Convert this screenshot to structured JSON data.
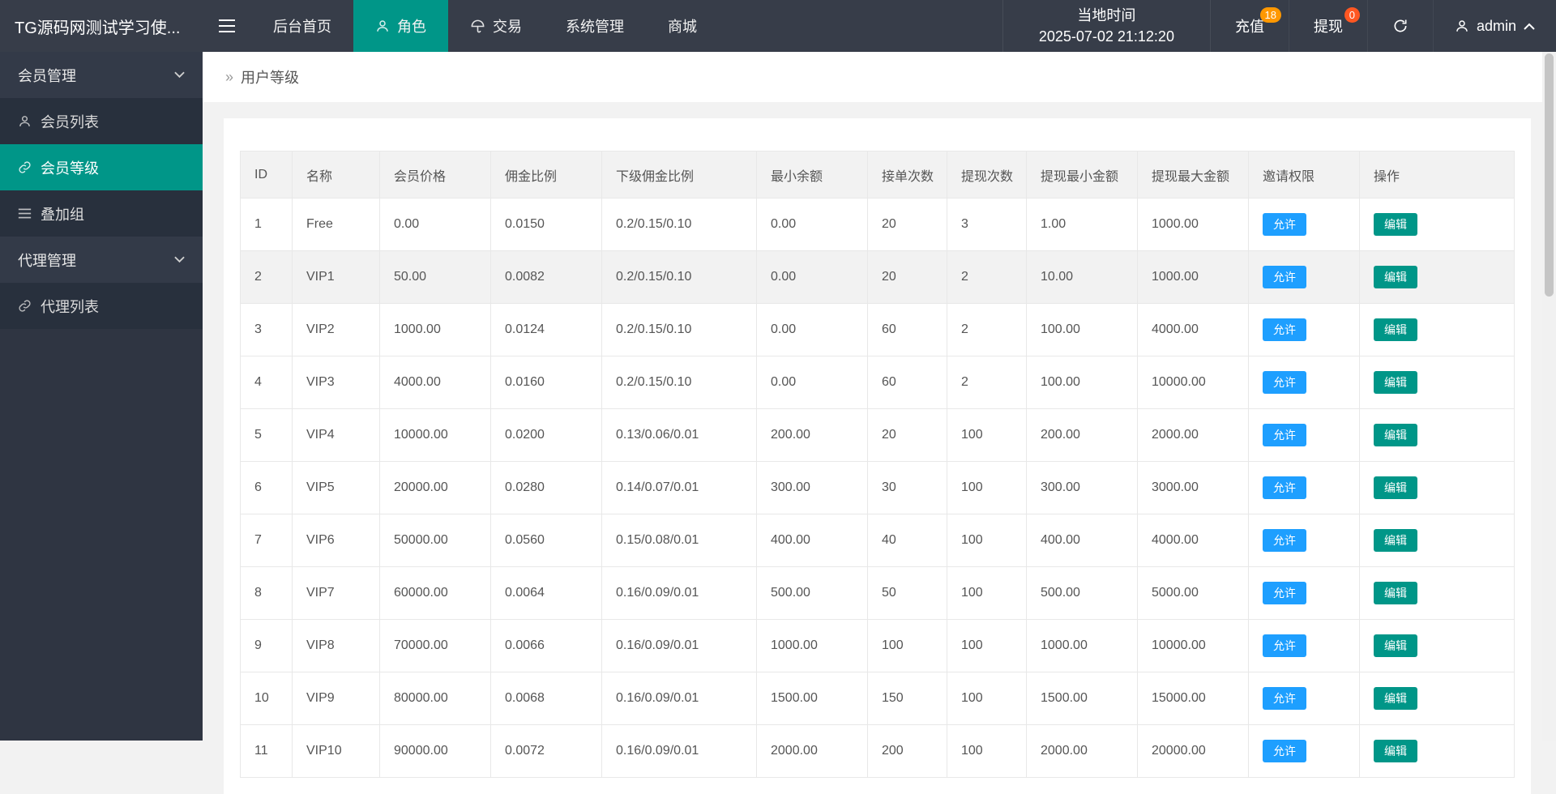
{
  "topbar": {
    "title": "TG源码网测试学习使...",
    "nav": [
      {
        "label": "后台首页"
      },
      {
        "label": "角色"
      },
      {
        "label": "交易"
      },
      {
        "label": "系统管理"
      },
      {
        "label": "商城"
      }
    ],
    "time_label": "当地时间",
    "time_value": "2025-07-02 21:12:20",
    "recharge_label": "充值",
    "recharge_badge": "18",
    "withdraw_label": "提现",
    "withdraw_badge": "0",
    "username": "admin",
    "colors": {
      "active_bg": "#009688",
      "recharge_badge_bg": "#ff9800",
      "withdraw_badge_bg": "#ff5722"
    }
  },
  "sidebar": {
    "items": [
      {
        "label": "会员管理"
      },
      {
        "label": "会员列表"
      },
      {
        "label": "会员等级"
      },
      {
        "label": "叠加组"
      },
      {
        "label": "代理管理"
      },
      {
        "label": "代理列表"
      }
    ]
  },
  "breadcrumb": {
    "title": "用户等级"
  },
  "table": {
    "headers": [
      "ID",
      "名称",
      "会员价格",
      "佣金比例",
      "下级佣金比例",
      "最小余额",
      "接单次数",
      "提现次数",
      "提现最小金额",
      "提现最大金额",
      "邀请权限",
      "操作"
    ],
    "allow_label": "允许",
    "edit_label": "编辑",
    "allow_color": "#1e9fff",
    "edit_color": "#009688",
    "rows": [
      {
        "id": "1",
        "name": "Free",
        "price": "0.00",
        "commission": "0.0150",
        "sub_commission": "0.2/0.15/0.10",
        "min_balance": "0.00",
        "orders": "20",
        "withdraw_times": "3",
        "withdraw_min": "1.00",
        "withdraw_max": "1000.00",
        "highlight": false
      },
      {
        "id": "2",
        "name": "VIP1",
        "price": "50.00",
        "commission": "0.0082",
        "sub_commission": "0.2/0.15/0.10",
        "min_balance": "0.00",
        "orders": "20",
        "withdraw_times": "2",
        "withdraw_min": "10.00",
        "withdraw_max": "1000.00",
        "highlight": true
      },
      {
        "id": "3",
        "name": "VIP2",
        "price": "1000.00",
        "commission": "0.0124",
        "sub_commission": "0.2/0.15/0.10",
        "min_balance": "0.00",
        "orders": "60",
        "withdraw_times": "2",
        "withdraw_min": "100.00",
        "withdraw_max": "4000.00",
        "highlight": false
      },
      {
        "id": "4",
        "name": "VIP3",
        "price": "4000.00",
        "commission": "0.0160",
        "sub_commission": "0.2/0.15/0.10",
        "min_balance": "0.00",
        "orders": "60",
        "withdraw_times": "2",
        "withdraw_min": "100.00",
        "withdraw_max": "10000.00",
        "highlight": false
      },
      {
        "id": "5",
        "name": "VIP4",
        "price": "10000.00",
        "commission": "0.0200",
        "sub_commission": "0.13/0.06/0.01",
        "min_balance": "200.00",
        "orders": "20",
        "withdraw_times": "100",
        "withdraw_min": "200.00",
        "withdraw_max": "2000.00",
        "highlight": false
      },
      {
        "id": "6",
        "name": "VIP5",
        "price": "20000.00",
        "commission": "0.0280",
        "sub_commission": "0.14/0.07/0.01",
        "min_balance": "300.00",
        "orders": "30",
        "withdraw_times": "100",
        "withdraw_min": "300.00",
        "withdraw_max": "3000.00",
        "highlight": false
      },
      {
        "id": "7",
        "name": "VIP6",
        "price": "50000.00",
        "commission": "0.0560",
        "sub_commission": "0.15/0.08/0.01",
        "min_balance": "400.00",
        "orders": "40",
        "withdraw_times": "100",
        "withdraw_min": "400.00",
        "withdraw_max": "4000.00",
        "highlight": false
      },
      {
        "id": "8",
        "name": "VIP7",
        "price": "60000.00",
        "commission": "0.0064",
        "sub_commission": "0.16/0.09/0.01",
        "min_balance": "500.00",
        "orders": "50",
        "withdraw_times": "100",
        "withdraw_min": "500.00",
        "withdraw_max": "5000.00",
        "highlight": false
      },
      {
        "id": "9",
        "name": "VIP8",
        "price": "70000.00",
        "commission": "0.0066",
        "sub_commission": "0.16/0.09/0.01",
        "min_balance": "1000.00",
        "orders": "100",
        "withdraw_times": "100",
        "withdraw_min": "1000.00",
        "withdraw_max": "10000.00",
        "highlight": false
      },
      {
        "id": "10",
        "name": "VIP9",
        "price": "80000.00",
        "commission": "0.0068",
        "sub_commission": "0.16/0.09/0.01",
        "min_balance": "1500.00",
        "orders": "150",
        "withdraw_times": "100",
        "withdraw_min": "1500.00",
        "withdraw_max": "15000.00",
        "highlight": false
      },
      {
        "id": "11",
        "name": "VIP10",
        "price": "90000.00",
        "commission": "0.0072",
        "sub_commission": "0.16/0.09/0.01",
        "min_balance": "2000.00",
        "orders": "200",
        "withdraw_times": "100",
        "withdraw_min": "2000.00",
        "withdraw_max": "20000.00",
        "highlight": false
      }
    ]
  }
}
